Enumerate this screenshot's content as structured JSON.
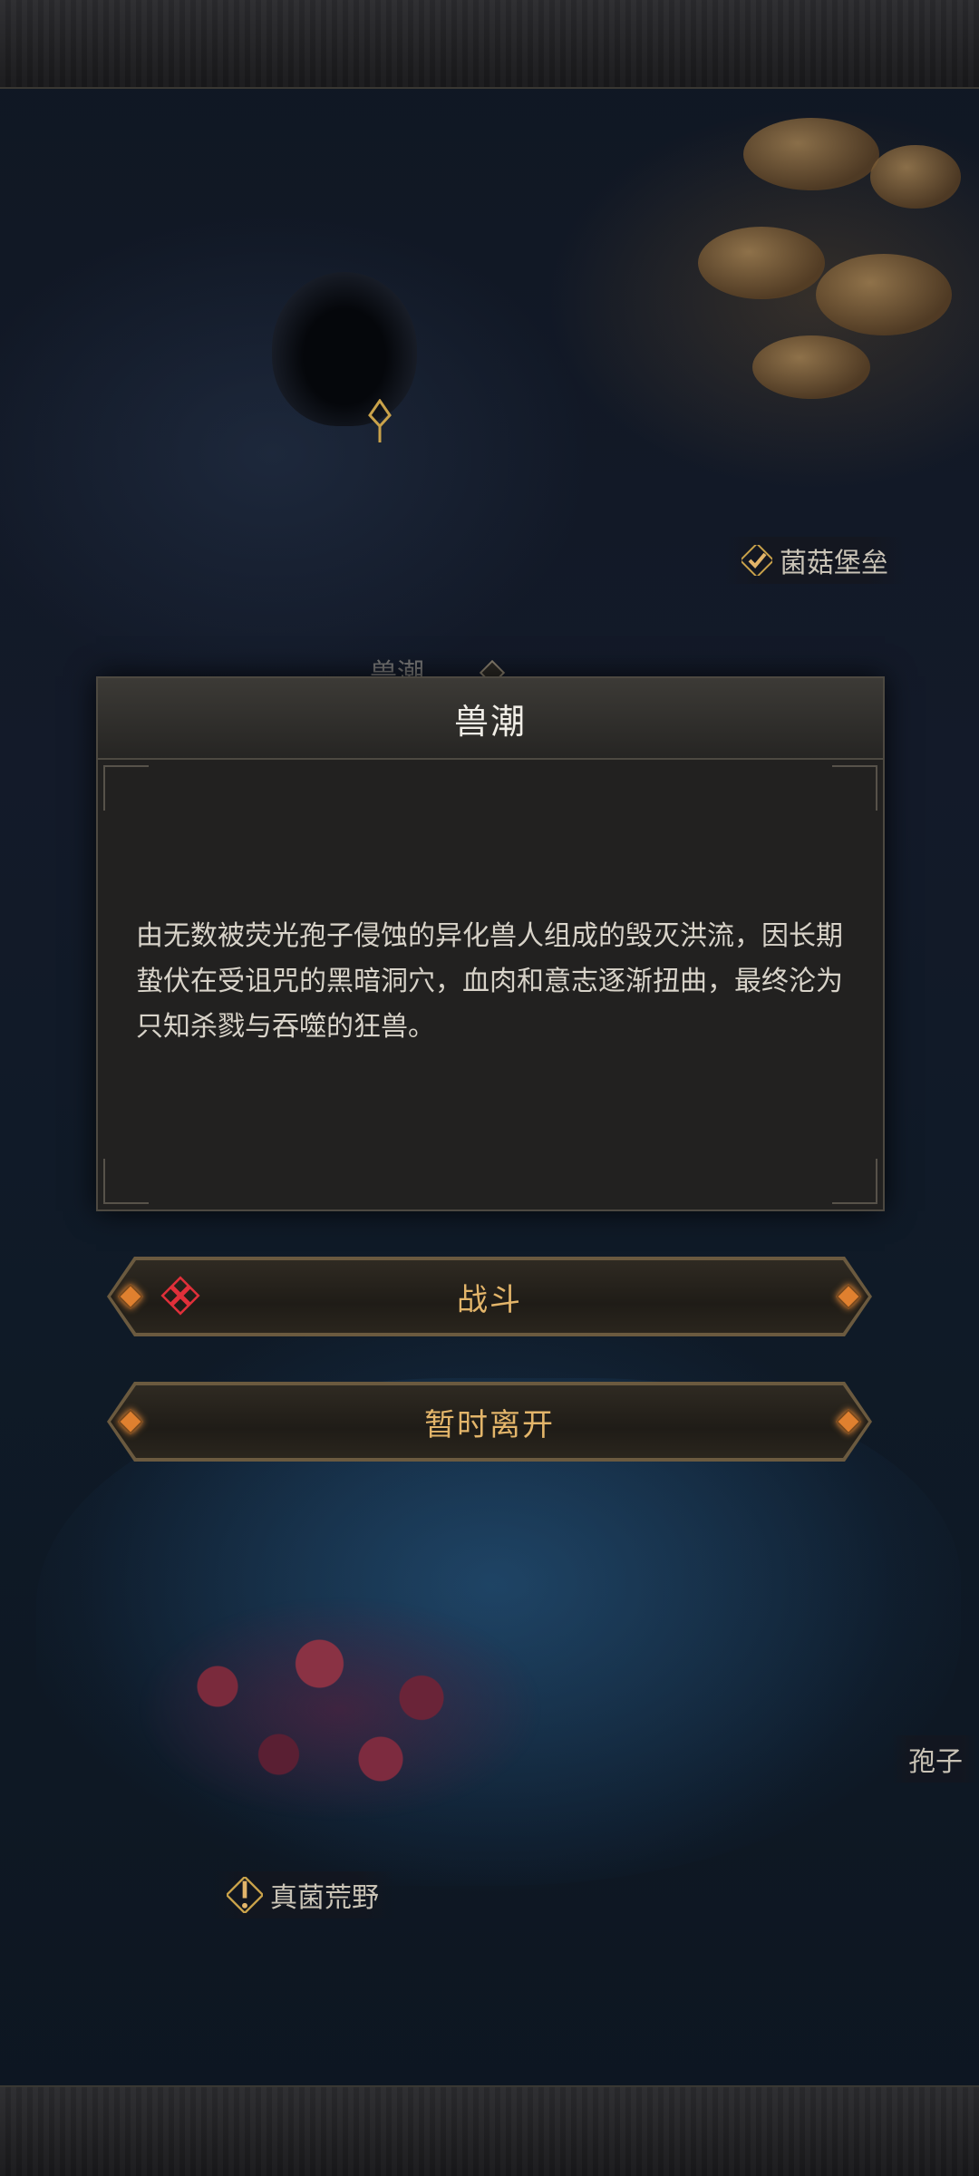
{
  "map": {
    "locations": {
      "mushroom_fortress": "菌菇堡垒",
      "beast_tide_partial": "兽潮",
      "spore_partial": "孢子",
      "fungal_wilds": "真菌荒野"
    }
  },
  "dialog": {
    "title": "兽潮",
    "description": "由无数被荧光孢子侵蚀的异化兽人组成的毁灭洪流，因长期蛰伏在受诅咒的黑暗洞穴，血肉和意志逐渐扭曲，最终沦为只知杀戮与吞噬的狂兽。"
  },
  "actions": {
    "fight_label": "战斗",
    "leave_label": "暂时离开"
  },
  "colors": {
    "accent_gold": "#e3b56a",
    "danger_red": "#e0303a",
    "gem_orange": "#e0802f"
  }
}
